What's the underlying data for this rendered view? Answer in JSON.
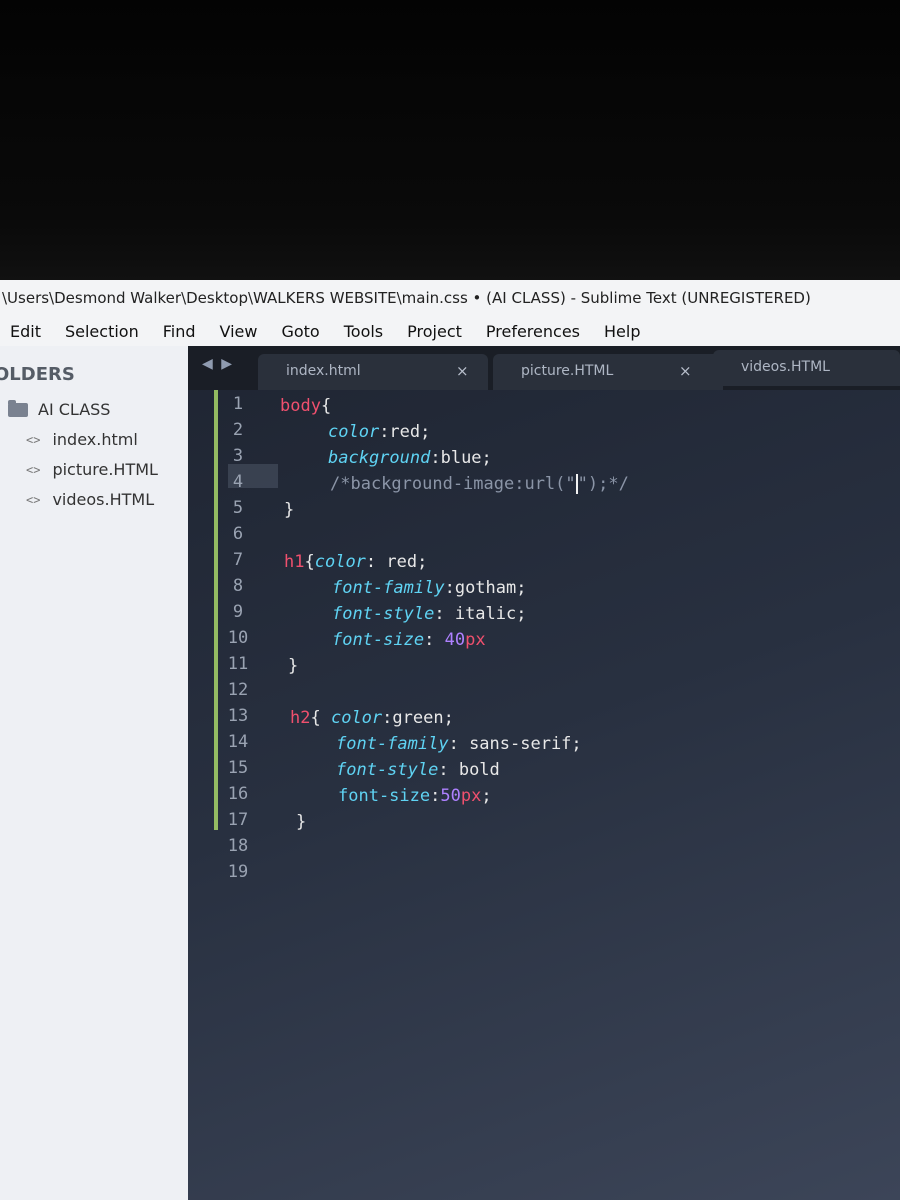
{
  "window": {
    "title": "\\Users\\Desmond Walker\\Desktop\\WALKERS WEBSITE\\main.css • (AI CLASS) - Sublime Text (UNREGISTERED)"
  },
  "menu": [
    "Edit",
    "Selection",
    "Find",
    "View",
    "Goto",
    "Tools",
    "Project",
    "Preferences",
    "Help"
  ],
  "sidebar": {
    "header": "OLDERS",
    "folder": "AI CLASS",
    "files": [
      "index.html",
      "picture.HTML",
      "videos.HTML"
    ]
  },
  "tabs": [
    {
      "label": "index.html",
      "close": "×"
    },
    {
      "label": "picture.HTML",
      "close": "×"
    },
    {
      "label": "videos.HTML",
      "close": ""
    }
  ],
  "tab_nav": "◀ ▶",
  "code": {
    "line_numbers": [
      "1",
      "2",
      "3",
      "4",
      "5",
      "6",
      "7",
      "8",
      "9",
      "10",
      "11",
      "12",
      "13",
      "14",
      "15",
      "16",
      "17",
      "18",
      "19"
    ],
    "l1_sel": "body",
    "l1_brace": "{",
    "l2_prop": "color",
    "l2_rest": ":red;",
    "l3_prop": "background",
    "l3_rest": ":blue;",
    "l4_a": "/*background-image:url(\"",
    "l4_b": "\");*/",
    "l5": "}",
    "l7_sel": "h1",
    "l7_brace": "{",
    "l7_prop": "color",
    "l7_rest": ": red;",
    "l8_prop": "font-family",
    "l8_rest": ":gotham;",
    "l9_prop": "font-style",
    "l9_rest": ": italic;",
    "l10_prop": "font-size",
    "l10_colon": ": ",
    "l10_num": "40",
    "l10_unit": "px",
    "l11": "}",
    "l13_sel": "h2",
    "l13_brace": "{ ",
    "l13_prop": "color",
    "l13_rest": ":green;",
    "l14_prop": "font-family",
    "l14_rest": ": sans-serif;",
    "l15_prop": "font-style",
    "l15_rest": ": bold",
    "l16_prop": "font-size",
    "l16_colon": ":",
    "l16_num": "50",
    "l16_unit": "px",
    "l16_end": ";",
    "l17": "}"
  }
}
